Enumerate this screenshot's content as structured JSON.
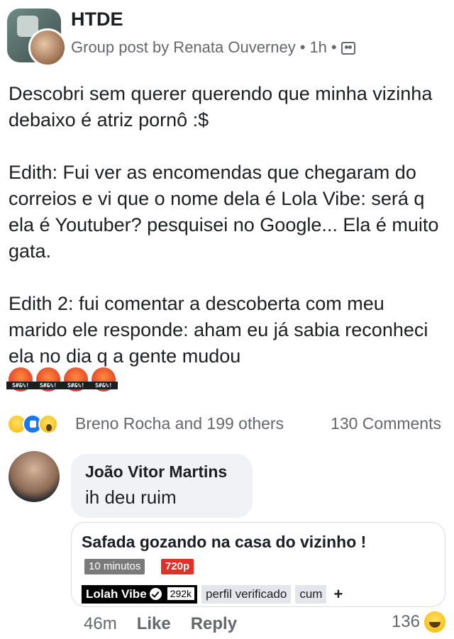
{
  "post": {
    "group_name": "HTDE",
    "meta": "Group post by Renata Ouverney",
    "time": "1h",
    "dot": "•",
    "paragraphs": [
      "Descobri sem querer querendo que minha vizinha debaixo é atriz pornô :$",
      "Edith: Fui ver as encomendas que chegaram do correios e vi que o nome dela é Lola Vibe: será q ela é Youtuber? pesquisei no Google... Ela é muito gata.",
      "Edith 2: fui comentar a descoberta com meu marido ele responde: aham eu já sabia reconheci ela no dia q a gente mudou"
    ],
    "emoji_label": "S#&%!",
    "emoji_count": 4
  },
  "reactions": {
    "icons": [
      "haha-icon",
      "like-icon",
      "wow-icon"
    ],
    "text": "Breno Rocha and 199 others",
    "comments": "130 Comments"
  },
  "comment": {
    "author": "João Vitor Martins",
    "text": "ih deu ruim",
    "preview": {
      "title": "Safada gozando na casa do vizinho !",
      "duration": "10 minutos",
      "quality": "720p",
      "channel": "Lolah Vibe",
      "subscribers": "292k",
      "tags": [
        "perfil verificado",
        "cum"
      ],
      "plus": "+"
    },
    "time": "46m",
    "like_label": "Like",
    "reply_label": "Reply",
    "reaction_count": "136"
  },
  "colors": {
    "text": "#1c1e21",
    "secondary": "#65676b",
    "bubble": "#f0f2f5",
    "like_blue": "#1877f2",
    "quality_red": "#e0302a"
  }
}
